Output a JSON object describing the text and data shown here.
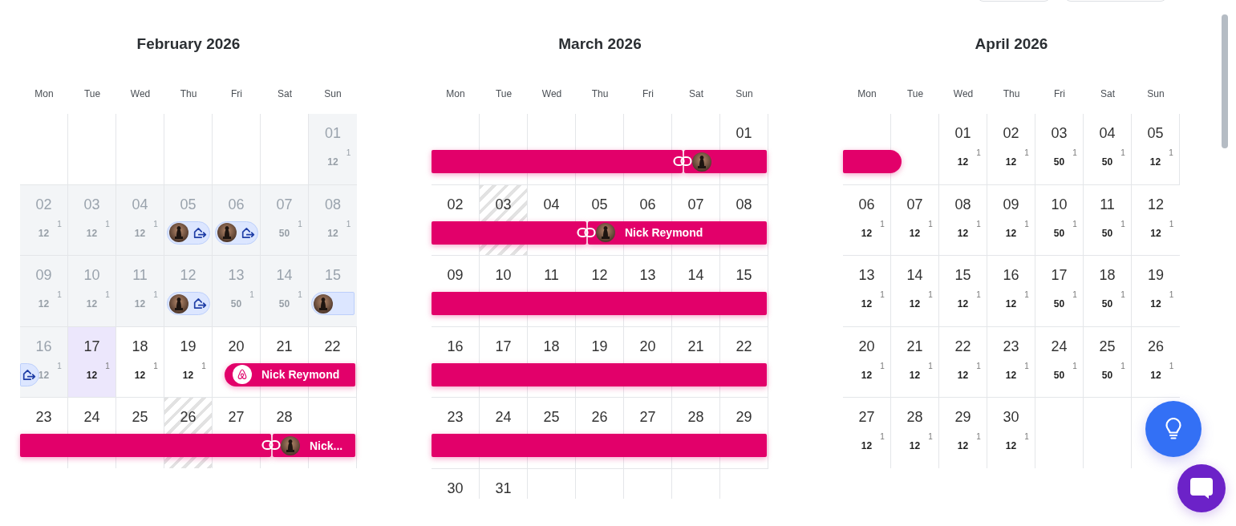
{
  "months": [
    {
      "title": "February 2026",
      "weekdays": [
        "Mon",
        "Tue",
        "Wed",
        "Thu",
        "Fri",
        "Sat",
        "Sun"
      ],
      "weeks": [
        {
          "cells": [
            {
              "kind": "empty"
            },
            {
              "kind": "empty"
            },
            {
              "kind": "empty"
            },
            {
              "kind": "empty"
            },
            {
              "kind": "empty"
            },
            {
              "kind": "empty"
            },
            {
              "kind": "day",
              "day": "01",
              "past": true,
              "today": false,
              "blocked": false,
              "price": "12",
              "count": "1"
            }
          ]
        },
        {
          "cells": [
            {
              "kind": "day",
              "day": "02",
              "past": true,
              "today": false,
              "blocked": false,
              "price": "12",
              "count": "1"
            },
            {
              "kind": "day",
              "day": "03",
              "past": true,
              "today": false,
              "blocked": false,
              "price": "12",
              "count": "1"
            },
            {
              "kind": "day",
              "day": "04",
              "past": true,
              "today": false,
              "blocked": false,
              "price": "12",
              "count": "1"
            },
            {
              "kind": "day",
              "day": "05",
              "past": true,
              "today": false,
              "blocked": false,
              "check_in": [
                {
                  "kind": "checkout",
                  "avatar": true,
                  "round": true
                }
              ]
            },
            {
              "kind": "day",
              "day": "06",
              "past": true,
              "today": false,
              "blocked": false,
              "check_out": [
                {
                  "kind": "checkout",
                  "house": true,
                  "round": true
                }
              ],
              "check_in": [
                {
                  "kind": "checkout",
                  "avatar": true,
                  "round": true
                }
              ]
            },
            {
              "kind": "day",
              "day": "07",
              "past": true,
              "today": false,
              "blocked": false,
              "price": "50",
              "count": "1",
              "check_out": [
                {
                  "kind": "checkout",
                  "house": true,
                  "round": true
                }
              ]
            },
            {
              "kind": "day",
              "day": "08",
              "past": true,
              "today": false,
              "blocked": false,
              "price": "12",
              "count": "1"
            }
          ]
        },
        {
          "cells": [
            {
              "kind": "day",
              "day": "09",
              "past": true,
              "today": false,
              "blocked": false,
              "price": "12",
              "count": "1"
            },
            {
              "kind": "day",
              "day": "10",
              "past": true,
              "today": false,
              "blocked": false,
              "price": "12",
              "count": "1"
            },
            {
              "kind": "day",
              "day": "11",
              "past": true,
              "today": false,
              "blocked": false,
              "price": "12",
              "count": "1"
            },
            {
              "kind": "day",
              "day": "12",
              "past": true,
              "today": false,
              "blocked": false,
              "check_in": [
                {
                  "kind": "checkout",
                  "avatar": true,
                  "round": true
                }
              ]
            },
            {
              "kind": "day",
              "day": "13",
              "past": true,
              "today": false,
              "blocked": false,
              "price": "50",
              "count": "1",
              "check_out": [
                {
                  "kind": "checkout",
                  "house": true,
                  "round": true
                }
              ]
            },
            {
              "kind": "day",
              "day": "14",
              "past": true,
              "today": false,
              "blocked": false,
              "price": "50",
              "count": "1"
            },
            {
              "kind": "day",
              "day": "15",
              "past": true,
              "today": false,
              "blocked": false,
              "check_in": [
                {
                  "kind": "checkout",
                  "avatar": true,
                  "round": true
                }
              ]
            }
          ]
        },
        {
          "continues": [
            {
              "kind": "checkout"
            }
          ],
          "cells": [
            {
              "kind": "day",
              "day": "16",
              "past": true,
              "today": false,
              "blocked": false,
              "price": "12",
              "count": "1",
              "check_out": [
                {
                  "kind": "checkout",
                  "house": true,
                  "round": true
                }
              ]
            },
            {
              "kind": "day",
              "day": "17",
              "past": false,
              "today": true,
              "blocked": false,
              "price": "12",
              "count": "1"
            },
            {
              "kind": "day",
              "day": "18",
              "past": false,
              "today": false,
              "blocked": false,
              "price": "12",
              "count": "1"
            },
            {
              "kind": "day",
              "day": "19",
              "past": false,
              "today": false,
              "blocked": false,
              "price": "12",
              "count": "1"
            },
            {
              "kind": "day",
              "day": "20",
              "past": false,
              "today": false,
              "blocked": false,
              "check_in": [
                {
                  "kind": "booking",
                  "logo": true,
                  "round": true,
                  "guest": "Nick Reymond"
                }
              ]
            },
            {
              "kind": "day",
              "day": "21",
              "past": false,
              "today": false,
              "blocked": false
            },
            {
              "kind": "day",
              "day": "22",
              "past": false,
              "today": false,
              "blocked": false
            }
          ]
        },
        {
          "continues": [
            {
              "kind": "booking"
            }
          ],
          "cells": [
            {
              "kind": "day",
              "day": "23",
              "past": false,
              "today": false,
              "blocked": false
            },
            {
              "kind": "day",
              "day": "24",
              "past": false,
              "today": false,
              "blocked": false
            },
            {
              "kind": "day",
              "day": "25",
              "past": false,
              "today": false,
              "blocked": false
            },
            {
              "kind": "day",
              "day": "26",
              "past": false,
              "today": false,
              "blocked": true
            },
            {
              "kind": "day",
              "day": "27",
              "past": false,
              "today": false,
              "blocked": false
            },
            {
              "kind": "day",
              "day": "28",
              "past": false,
              "today": false,
              "blocked": false,
              "check_out": [
                {
                  "kind": "booking",
                  "link": true
                }
              ],
              "check_in": [
                {
                  "kind": "booking",
                  "avatar": true,
                  "guest": "Nick..."
                }
              ]
            },
            {
              "kind": "empty"
            }
          ]
        }
      ]
    },
    {
      "title": "March 2026",
      "weekdays": [
        "Mon",
        "Tue",
        "Wed",
        "Thu",
        "Fri",
        "Sat",
        "Sun"
      ],
      "weeks": [
        {
          "continues": [
            {
              "kind": "booking"
            }
          ],
          "cells": [
            {
              "kind": "empty"
            },
            {
              "kind": "empty"
            },
            {
              "kind": "empty"
            },
            {
              "kind": "empty"
            },
            {
              "kind": "empty"
            },
            {
              "kind": "empty",
              "check_out": [
                {
                  "kind": "booking",
                  "link": true
                }
              ],
              "check_in": [
                {
                  "kind": "booking",
                  "avatar": true
                }
              ]
            },
            {
              "kind": "day",
              "day": "01",
              "past": false,
              "today": false,
              "blocked": false
            }
          ]
        },
        {
          "continues": [
            {
              "kind": "booking"
            }
          ],
          "cells": [
            {
              "kind": "day",
              "day": "02",
              "past": false,
              "today": false,
              "blocked": false
            },
            {
              "kind": "day",
              "day": "03",
              "past": false,
              "today": false,
              "blocked": true
            },
            {
              "kind": "day",
              "day": "04",
              "past": false,
              "today": false,
              "blocked": false
            },
            {
              "kind": "day",
              "day": "05",
              "past": false,
              "today": false,
              "blocked": false,
              "check_out": [
                {
                  "kind": "booking",
                  "link": true
                }
              ],
              "check_in": [
                {
                  "kind": "booking",
                  "avatar": true,
                  "guest": "Nick Reymond"
                }
              ]
            },
            {
              "kind": "day",
              "day": "06",
              "past": false,
              "today": false,
              "blocked": false
            },
            {
              "kind": "day",
              "day": "07",
              "past": false,
              "today": false,
              "blocked": false
            },
            {
              "kind": "day",
              "day": "08",
              "past": false,
              "today": false,
              "blocked": false
            }
          ]
        },
        {
          "continues": [
            {
              "kind": "booking"
            }
          ],
          "cells": [
            {
              "kind": "day",
              "day": "09",
              "past": false,
              "today": false,
              "blocked": false
            },
            {
              "kind": "day",
              "day": "10",
              "past": false,
              "today": false,
              "blocked": false
            },
            {
              "kind": "day",
              "day": "11",
              "past": false,
              "today": false,
              "blocked": false
            },
            {
              "kind": "day",
              "day": "12",
              "past": false,
              "today": false,
              "blocked": false
            },
            {
              "kind": "day",
              "day": "13",
              "past": false,
              "today": false,
              "blocked": false
            },
            {
              "kind": "day",
              "day": "14",
              "past": false,
              "today": false,
              "blocked": false
            },
            {
              "kind": "day",
              "day": "15",
              "past": false,
              "today": false,
              "blocked": false
            }
          ]
        },
        {
          "continues": [
            {
              "kind": "booking"
            }
          ],
          "cells": [
            {
              "kind": "day",
              "day": "16",
              "past": false,
              "today": false,
              "blocked": false
            },
            {
              "kind": "day",
              "day": "17",
              "past": false,
              "today": false,
              "blocked": false
            },
            {
              "kind": "day",
              "day": "18",
              "past": false,
              "today": false,
              "blocked": false
            },
            {
              "kind": "day",
              "day": "19",
              "past": false,
              "today": false,
              "blocked": false
            },
            {
              "kind": "day",
              "day": "20",
              "past": false,
              "today": false,
              "blocked": false
            },
            {
              "kind": "day",
              "day": "21",
              "past": false,
              "today": false,
              "blocked": false
            },
            {
              "kind": "day",
              "day": "22",
              "past": false,
              "today": false,
              "blocked": false
            }
          ]
        },
        {
          "continues": [
            {
              "kind": "booking"
            }
          ],
          "cells": [
            {
              "kind": "day",
              "day": "23",
              "past": false,
              "today": false,
              "blocked": false
            },
            {
              "kind": "day",
              "day": "24",
              "past": false,
              "today": false,
              "blocked": false
            },
            {
              "kind": "day",
              "day": "25",
              "past": false,
              "today": false,
              "blocked": false
            },
            {
              "kind": "day",
              "day": "26",
              "past": false,
              "today": false,
              "blocked": false
            },
            {
              "kind": "day",
              "day": "27",
              "past": false,
              "today": false,
              "blocked": false
            },
            {
              "kind": "day",
              "day": "28",
              "past": false,
              "today": false,
              "blocked": false
            },
            {
              "kind": "day",
              "day": "29",
              "past": false,
              "today": false,
              "blocked": false
            }
          ]
        },
        {
          "cells": [
            {
              "kind": "day",
              "day": "30",
              "past": false,
              "today": false,
              "blocked": false
            },
            {
              "kind": "day",
              "day": "31",
              "past": false,
              "today": false,
              "blocked": false
            },
            {
              "kind": "empty"
            },
            {
              "kind": "empty"
            },
            {
              "kind": "empty"
            },
            {
              "kind": "empty"
            },
            {
              "kind": "empty"
            }
          ]
        }
      ]
    },
    {
      "title": "April 2026",
      "weekdays": [
        "Mon",
        "Tue",
        "Wed",
        "Thu",
        "Fri",
        "Sat",
        "Sun"
      ],
      "weeks": [
        {
          "continues": [
            {
              "kind": "booking"
            }
          ],
          "cells": [
            {
              "kind": "empty"
            },
            {
              "kind": "empty",
              "check_out": [
                {
                  "kind": "booking",
                  "round": true
                }
              ]
            },
            {
              "kind": "day",
              "day": "01",
              "past": false,
              "today": false,
              "blocked": false,
              "price": "12",
              "count": "1"
            },
            {
              "kind": "day",
              "day": "02",
              "past": false,
              "today": false,
              "blocked": false,
              "price": "12",
              "count": "1"
            },
            {
              "kind": "day",
              "day": "03",
              "past": false,
              "today": false,
              "blocked": false,
              "price": "50",
              "count": "1"
            },
            {
              "kind": "day",
              "day": "04",
              "past": false,
              "today": false,
              "blocked": false,
              "price": "50",
              "count": "1"
            },
            {
              "kind": "day",
              "day": "05",
              "past": false,
              "today": false,
              "blocked": false,
              "price": "12",
              "count": "1"
            }
          ]
        },
        {
          "cells": [
            {
              "kind": "day",
              "day": "06",
              "past": false,
              "today": false,
              "blocked": false,
              "price": "12",
              "count": "1"
            },
            {
              "kind": "day",
              "day": "07",
              "past": false,
              "today": false,
              "blocked": false,
              "price": "12",
              "count": "1"
            },
            {
              "kind": "day",
              "day": "08",
              "past": false,
              "today": false,
              "blocked": false,
              "price": "12",
              "count": "1"
            },
            {
              "kind": "day",
              "day": "09",
              "past": false,
              "today": false,
              "blocked": false,
              "price": "12",
              "count": "1"
            },
            {
              "kind": "day",
              "day": "10",
              "past": false,
              "today": false,
              "blocked": false,
              "price": "50",
              "count": "1"
            },
            {
              "kind": "day",
              "day": "11",
              "past": false,
              "today": false,
              "blocked": false,
              "price": "50",
              "count": "1"
            },
            {
              "kind": "day",
              "day": "12",
              "past": false,
              "today": false,
              "blocked": false,
              "price": "12",
              "count": "1"
            }
          ]
        },
        {
          "cells": [
            {
              "kind": "day",
              "day": "13",
              "past": false,
              "today": false,
              "blocked": false,
              "price": "12",
              "count": "1"
            },
            {
              "kind": "day",
              "day": "14",
              "past": false,
              "today": false,
              "blocked": false,
              "price": "12",
              "count": "1"
            },
            {
              "kind": "day",
              "day": "15",
              "past": false,
              "today": false,
              "blocked": false,
              "price": "12",
              "count": "1"
            },
            {
              "kind": "day",
              "day": "16",
              "past": false,
              "today": false,
              "blocked": false,
              "price": "12",
              "count": "1"
            },
            {
              "kind": "day",
              "day": "17",
              "past": false,
              "today": false,
              "blocked": false,
              "price": "50",
              "count": "1"
            },
            {
              "kind": "day",
              "day": "18",
              "past": false,
              "today": false,
              "blocked": false,
              "price": "50",
              "count": "1"
            },
            {
              "kind": "day",
              "day": "19",
              "past": false,
              "today": false,
              "blocked": false,
              "price": "12",
              "count": "1"
            }
          ]
        },
        {
          "cells": [
            {
              "kind": "day",
              "day": "20",
              "past": false,
              "today": false,
              "blocked": false,
              "price": "12",
              "count": "1"
            },
            {
              "kind": "day",
              "day": "21",
              "past": false,
              "today": false,
              "blocked": false,
              "price": "12",
              "count": "1"
            },
            {
              "kind": "day",
              "day": "22",
              "past": false,
              "today": false,
              "blocked": false,
              "price": "12",
              "count": "1"
            },
            {
              "kind": "day",
              "day": "23",
              "past": false,
              "today": false,
              "blocked": false,
              "price": "12",
              "count": "1"
            },
            {
              "kind": "day",
              "day": "24",
              "past": false,
              "today": false,
              "blocked": false,
              "price": "50",
              "count": "1"
            },
            {
              "kind": "day",
              "day": "25",
              "past": false,
              "today": false,
              "blocked": false,
              "price": "50",
              "count": "1"
            },
            {
              "kind": "day",
              "day": "26",
              "past": false,
              "today": false,
              "blocked": false,
              "price": "12",
              "count": "1"
            }
          ]
        },
        {
          "cells": [
            {
              "kind": "day",
              "day": "27",
              "past": false,
              "today": false,
              "blocked": false,
              "price": "12",
              "count": "1"
            },
            {
              "kind": "day",
              "day": "28",
              "past": false,
              "today": false,
              "blocked": false,
              "price": "12",
              "count": "1"
            },
            {
              "kind": "day",
              "day": "29",
              "past": false,
              "today": false,
              "blocked": false,
              "price": "12",
              "count": "1"
            },
            {
              "kind": "day",
              "day": "30",
              "past": false,
              "today": false,
              "blocked": false,
              "price": "12",
              "count": "1"
            },
            {
              "kind": "empty"
            },
            {
              "kind": "empty"
            },
            {
              "kind": "empty"
            }
          ]
        }
      ]
    }
  ]
}
